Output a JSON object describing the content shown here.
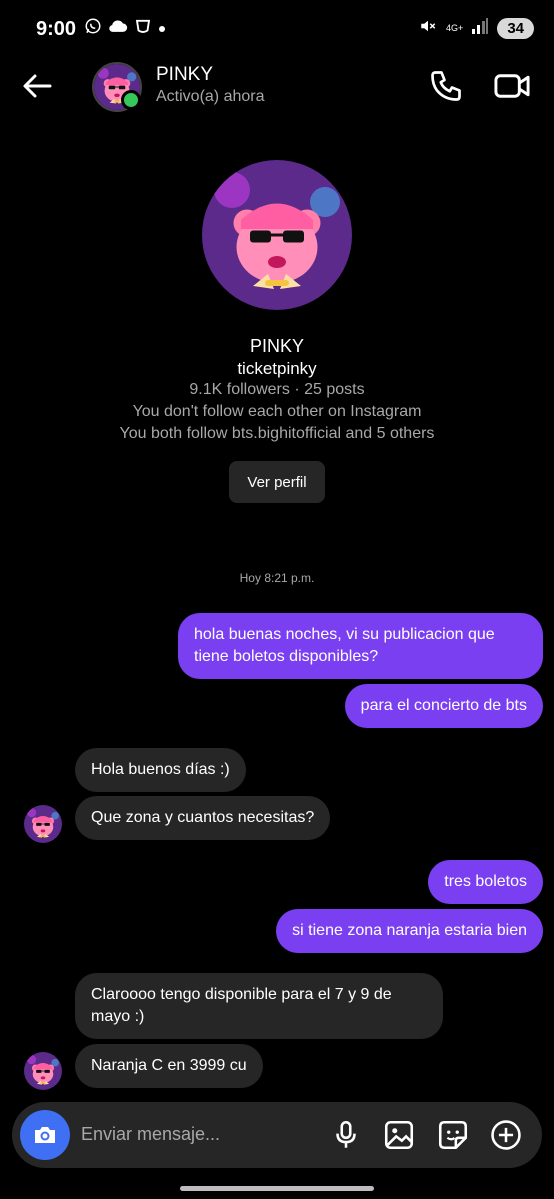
{
  "status_bar": {
    "time": "9:00",
    "network": "4G+",
    "battery": "34",
    "icons_left": [
      "whatsapp-icon",
      "cloud-icon",
      "app-icon",
      "dot-icon"
    ],
    "icons_right": [
      "mute-icon",
      "network-icon",
      "signal-icon",
      "battery-icon"
    ]
  },
  "header": {
    "name": "PINKY",
    "status": "Activo(a) ahora",
    "icons": [
      "back-arrow-icon",
      "phone-icon",
      "video-camera-icon"
    ],
    "online_color": "#35c759"
  },
  "profile": {
    "name": "PINKY",
    "username": "ticketpinky",
    "stats": "9.1K followers · 25 posts",
    "follow_note": "You don't follow each other on Instagram",
    "mutual": "You both follow bts.bighitofficial and 5 others",
    "button": "Ver perfil"
  },
  "timestamp": "Hoy 8:21 p.m.",
  "messages": [
    {
      "from": "me",
      "text": "hola buenas noches, vi su publicacion que tiene boletos disponibles?"
    },
    {
      "from": "me",
      "text": "para el concierto de bts"
    },
    {
      "from": "them",
      "text": "Hola buenos días :)"
    },
    {
      "from": "them",
      "text": "Que zona y cuantos necesitas?"
    },
    {
      "from": "me",
      "text": "tres boletos"
    },
    {
      "from": "me",
      "text": "si tiene zona naranja estaria bien"
    },
    {
      "from": "them",
      "text": "Claroooo tengo disponible para el 7 y 9 de mayo :)"
    },
    {
      "from": "them",
      "text": "Naranja C en 3999 cu"
    }
  ],
  "composer": {
    "placeholder": "Enviar mensaje...",
    "icons": [
      "camera-icon",
      "microphone-icon",
      "gallery-icon",
      "sticker-icon",
      "plus-icon"
    ]
  },
  "colors": {
    "outgoing_bubble": "#7b3ff2",
    "incoming_bubble": "#262626",
    "camera_button": "#3f6ff2",
    "background": "#000000"
  }
}
